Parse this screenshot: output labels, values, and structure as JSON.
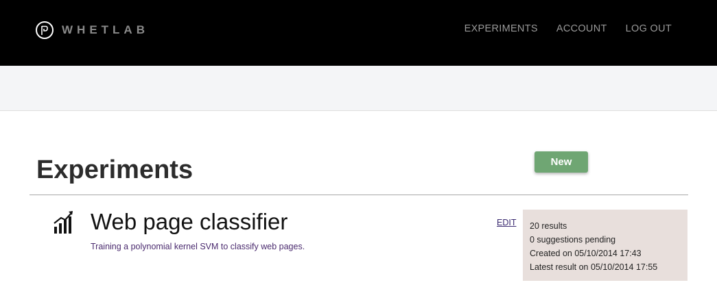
{
  "brand": {
    "name": "WHETLAB"
  },
  "nav": {
    "items": [
      {
        "label": "EXPERIMENTS"
      },
      {
        "label": "ACCOUNT"
      },
      {
        "label": "LOG OUT"
      }
    ]
  },
  "main": {
    "title": "Experiments",
    "new_label": "New",
    "experiment": {
      "name": "Web page classifier",
      "description": "Training a polynomial kernel SVM to classify web pages.",
      "edit_label": "EDIT",
      "icon": "bar-chart-trend-icon",
      "stats": {
        "results": "20 results",
        "pending": "0 suggestions pending",
        "created": "Created on 05/10/2014 17:43",
        "latest": "Latest result on 05/10/2014 17:55"
      }
    }
  },
  "colors": {
    "header_bg": "#000000",
    "subbar_bg": "#f4f5f7",
    "accent_green": "#6fa673",
    "stats_bg": "#e8dfdc",
    "link_purple": "#4a2a6e"
  }
}
